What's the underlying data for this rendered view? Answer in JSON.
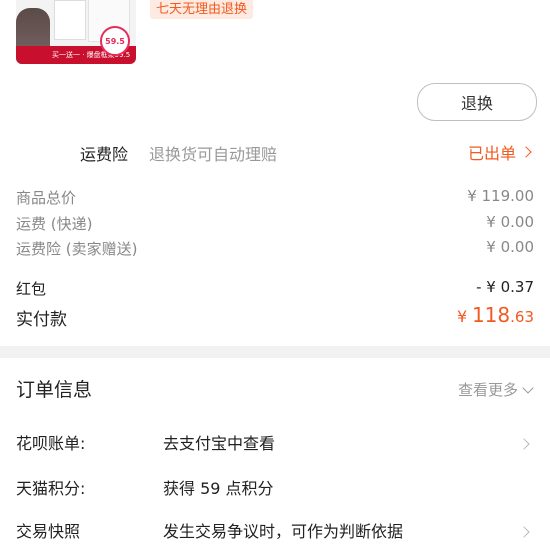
{
  "product": {
    "thumb_banner": "买一送一 · 爆盘框架59.5",
    "thumb_price": "59.5",
    "tag": "七天无理由退换"
  },
  "actions": {
    "return_label": "退换"
  },
  "insurance": {
    "label": "运费险",
    "desc": "退换货可自动理赔",
    "status": "已出单"
  },
  "price_summary": {
    "rows": [
      {
        "label": "商品总价",
        "amount": "¥ 119.00"
      },
      {
        "label": "运费 (快递)",
        "amount": "¥ 0.00"
      },
      {
        "label": "运费险 (卖家赠送)",
        "amount": "¥ 0.00"
      }
    ],
    "red_packet": {
      "label": "红包",
      "amount": "- ¥ 0.37"
    },
    "paid": {
      "label": "实付款",
      "currency": "¥",
      "int": "118",
      "dec": ".63"
    }
  },
  "order_info": {
    "title": "订单信息",
    "more": "查看更多",
    "rows": [
      {
        "label": "花呗账单:",
        "value": "去支付宝中查看"
      },
      {
        "label": "天猫积分:",
        "value": "获得 59 点积分"
      },
      {
        "label": "交易快照",
        "value": "发生交易争议时，可作为判断依据"
      }
    ]
  },
  "colors": {
    "accent": "#f25a1f",
    "band": "#f2f2f2"
  }
}
